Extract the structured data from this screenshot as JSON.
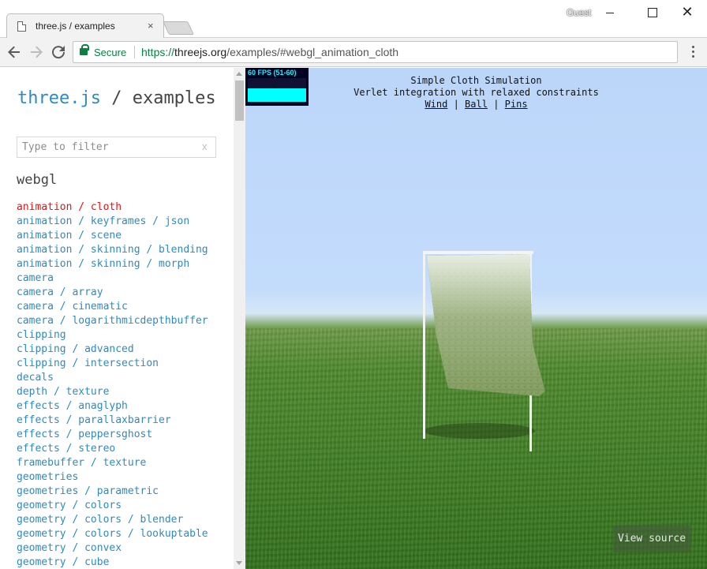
{
  "browser": {
    "tab_title": "three.js / examples",
    "tab_close": "×",
    "profile": "Guest",
    "secure_label": "Secure",
    "url_scheme": "https://",
    "url_host": "threejs.org",
    "url_path": "/examples/#webgl_animation_cloth",
    "icons": [
      "page-icon",
      "back-arrow-icon",
      "forward-arrow-icon",
      "reload-icon",
      "lock-icon",
      "menu-dots-icon",
      "minimize-icon",
      "maximize-icon",
      "close-icon"
    ]
  },
  "sidebar": {
    "brand_link": "three.js",
    "brand_rest": " / examples",
    "filter_placeholder": "Type to filter",
    "filter_clear": "x",
    "section": "webgl",
    "active_color": "#ee1010",
    "link_color": "#2f8abf",
    "items": [
      "animation / cloth",
      "animation / keyframes / json",
      "animation / scene",
      "animation / skinning / blending",
      "animation / skinning / morph",
      "camera",
      "camera / array",
      "camera / cinematic",
      "camera / logarithmicdepthbuffer",
      "clipping",
      "clipping / advanced",
      "clipping / intersection",
      "decals",
      "depth / texture",
      "effects / anaglyph",
      "effects / parallaxbarrier",
      "effects / peppersghost",
      "effects / stereo",
      "framebuffer / texture",
      "geometries",
      "geometries / parametric",
      "geometry / colors",
      "geometry / colors / blender",
      "geometry / colors / lookuptable",
      "geometry / convex",
      "geometry / cube"
    ]
  },
  "viewport": {
    "stats": "60 FPS (51-60)",
    "stats_level": 0.58,
    "title": "Simple Cloth Simulation",
    "subtitle": "Verlet integration with relaxed constraints",
    "link_wind": "Wind",
    "link_ball": "Ball",
    "link_pins": "Pins",
    "separator": "|",
    "view_source": "View source"
  }
}
